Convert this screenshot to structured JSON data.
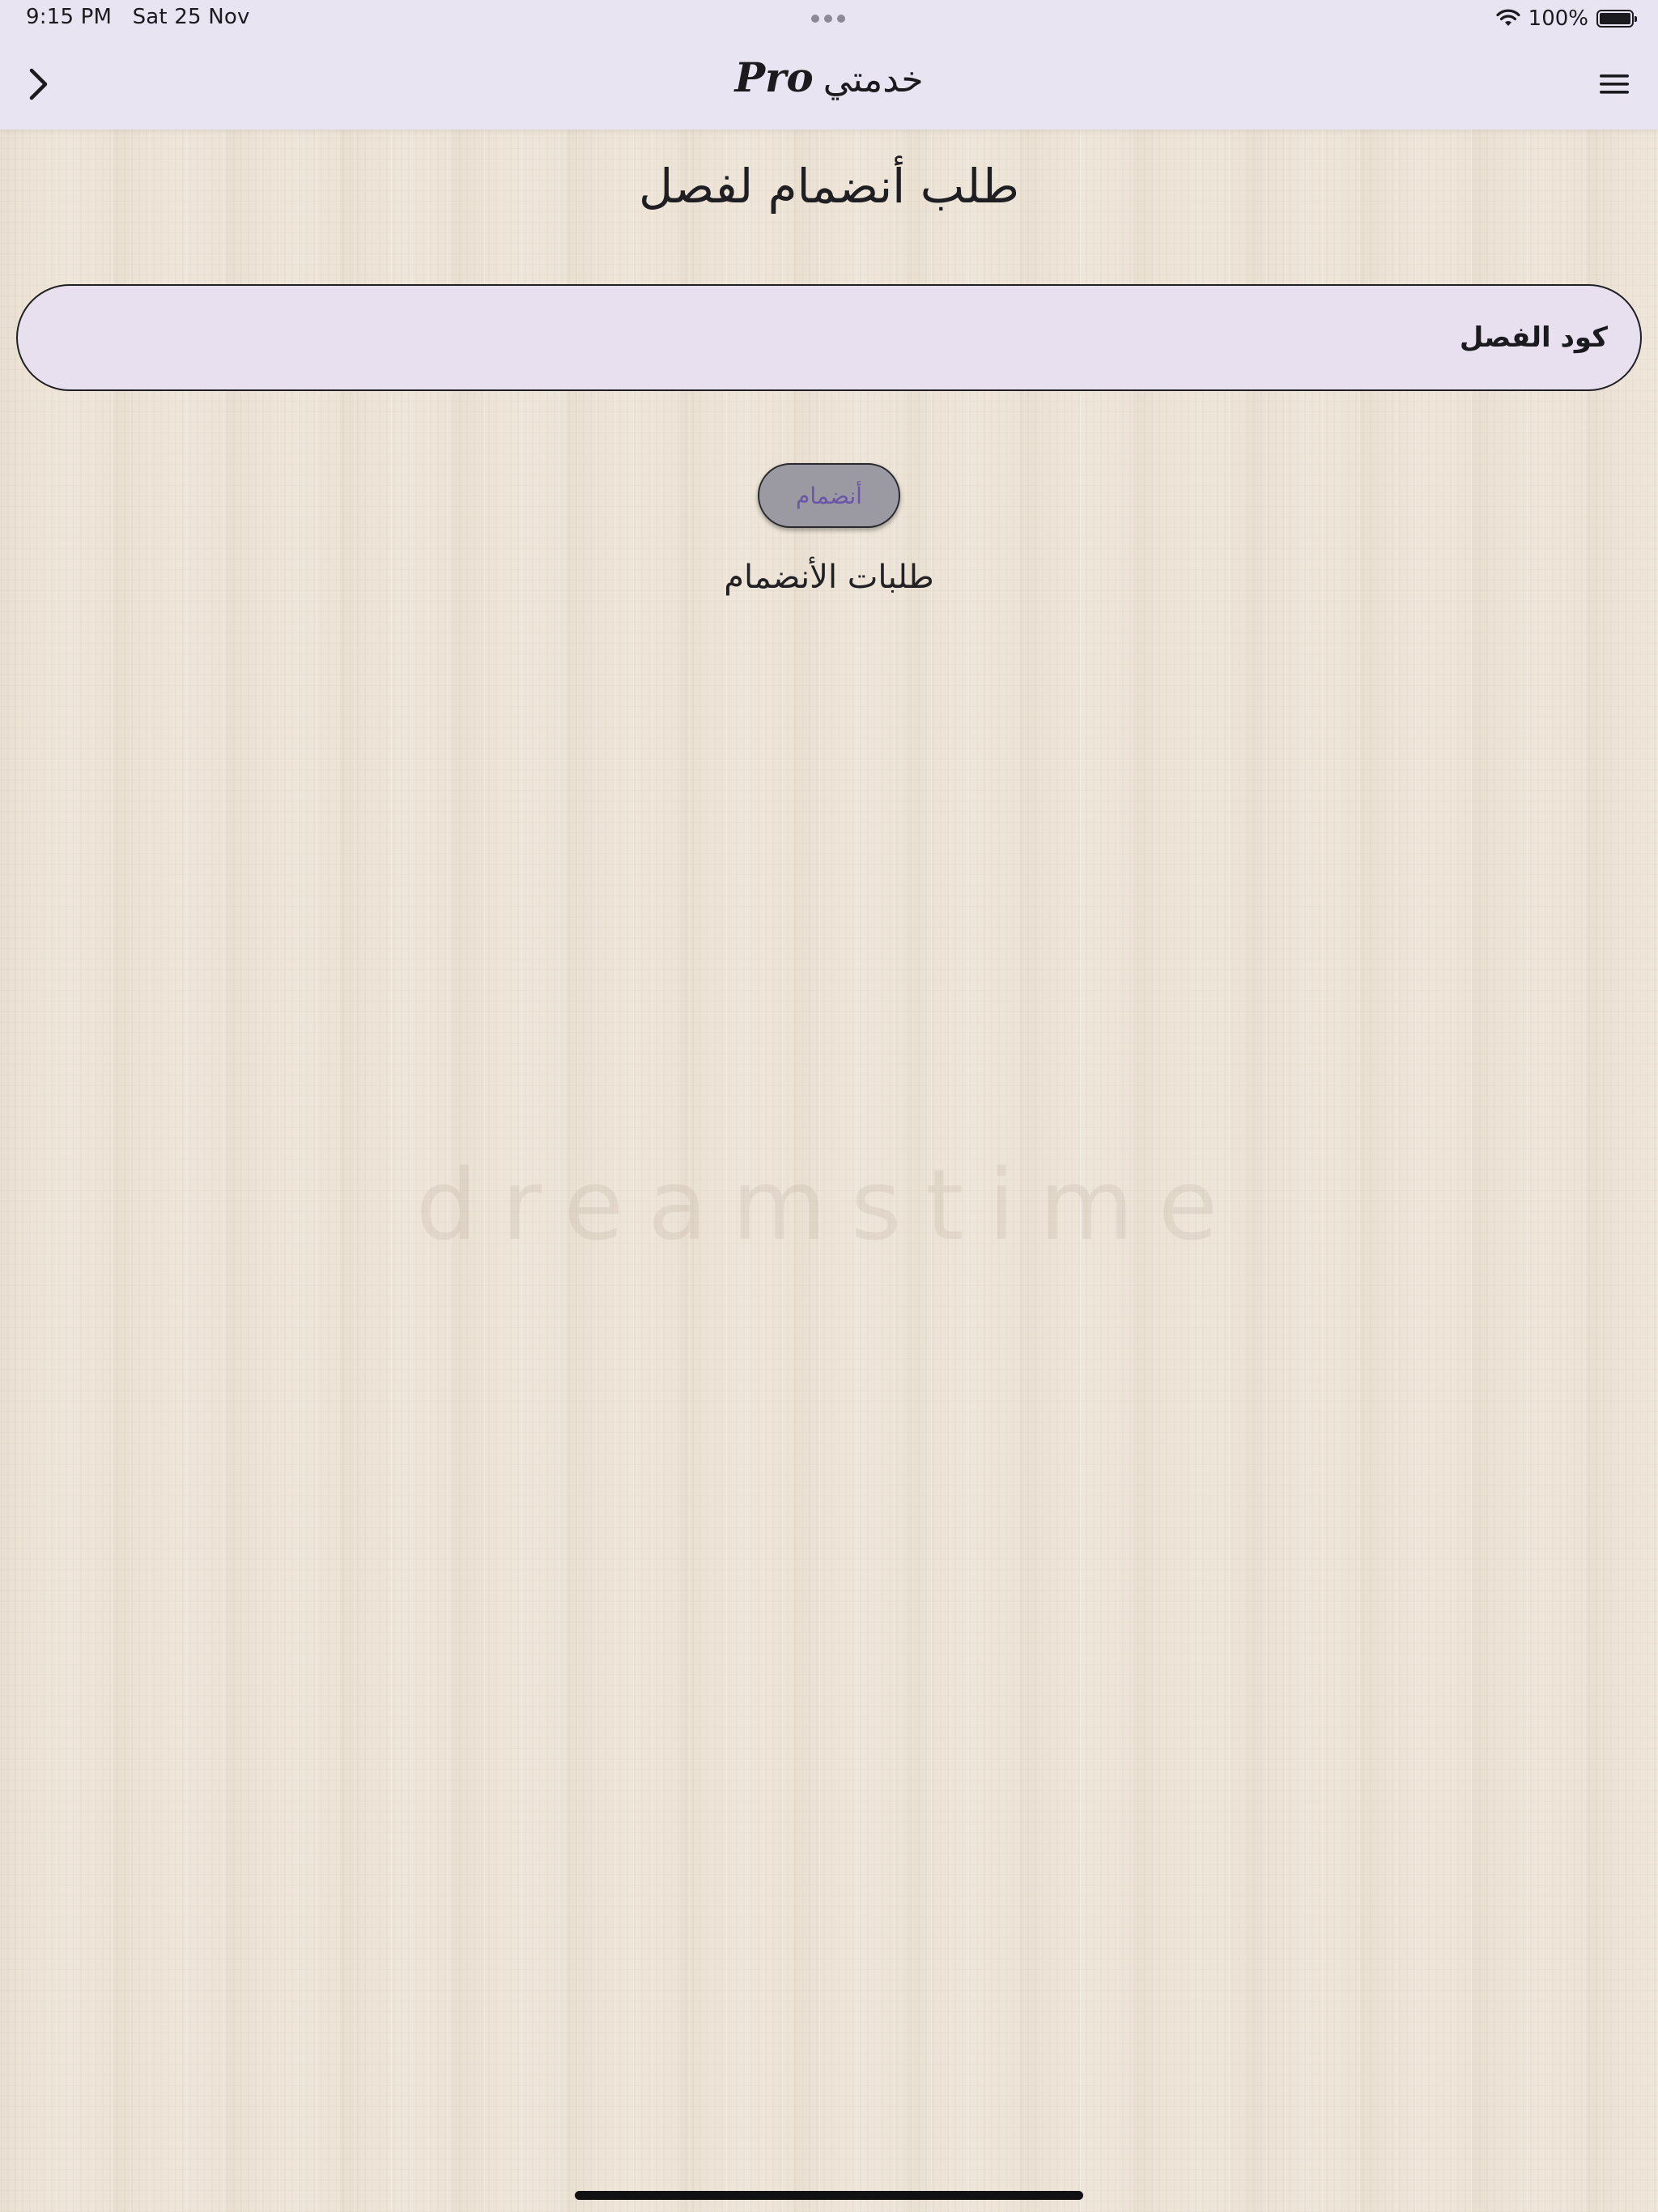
{
  "status_bar": {
    "time": "9:15 PM",
    "date": "Sat 25 Nov",
    "battery_percent": "100%",
    "battery_level": 1.0,
    "icons": [
      "multitask-dots-icon",
      "wifi-icon",
      "battery-icon"
    ]
  },
  "nav": {
    "back_icon": "chevron-right-icon",
    "title_pro": "Pro",
    "title_arabic": "خدمتي",
    "menu_icon": "hamburger-menu-icon"
  },
  "page": {
    "heading": "طلب أنضمام لفصل",
    "code_field": {
      "placeholder": "كود الفصل",
      "value": ""
    },
    "join_button_label": "أنضمام",
    "requests_link": "طلبات الأنضمام"
  },
  "colors": {
    "topbar_bg": "#e9e4f2",
    "field_bg": "#e8e0ee",
    "button_bg": "#9b9aa3",
    "button_text": "#6a55a8",
    "page_bg": "#ede4d7"
  }
}
